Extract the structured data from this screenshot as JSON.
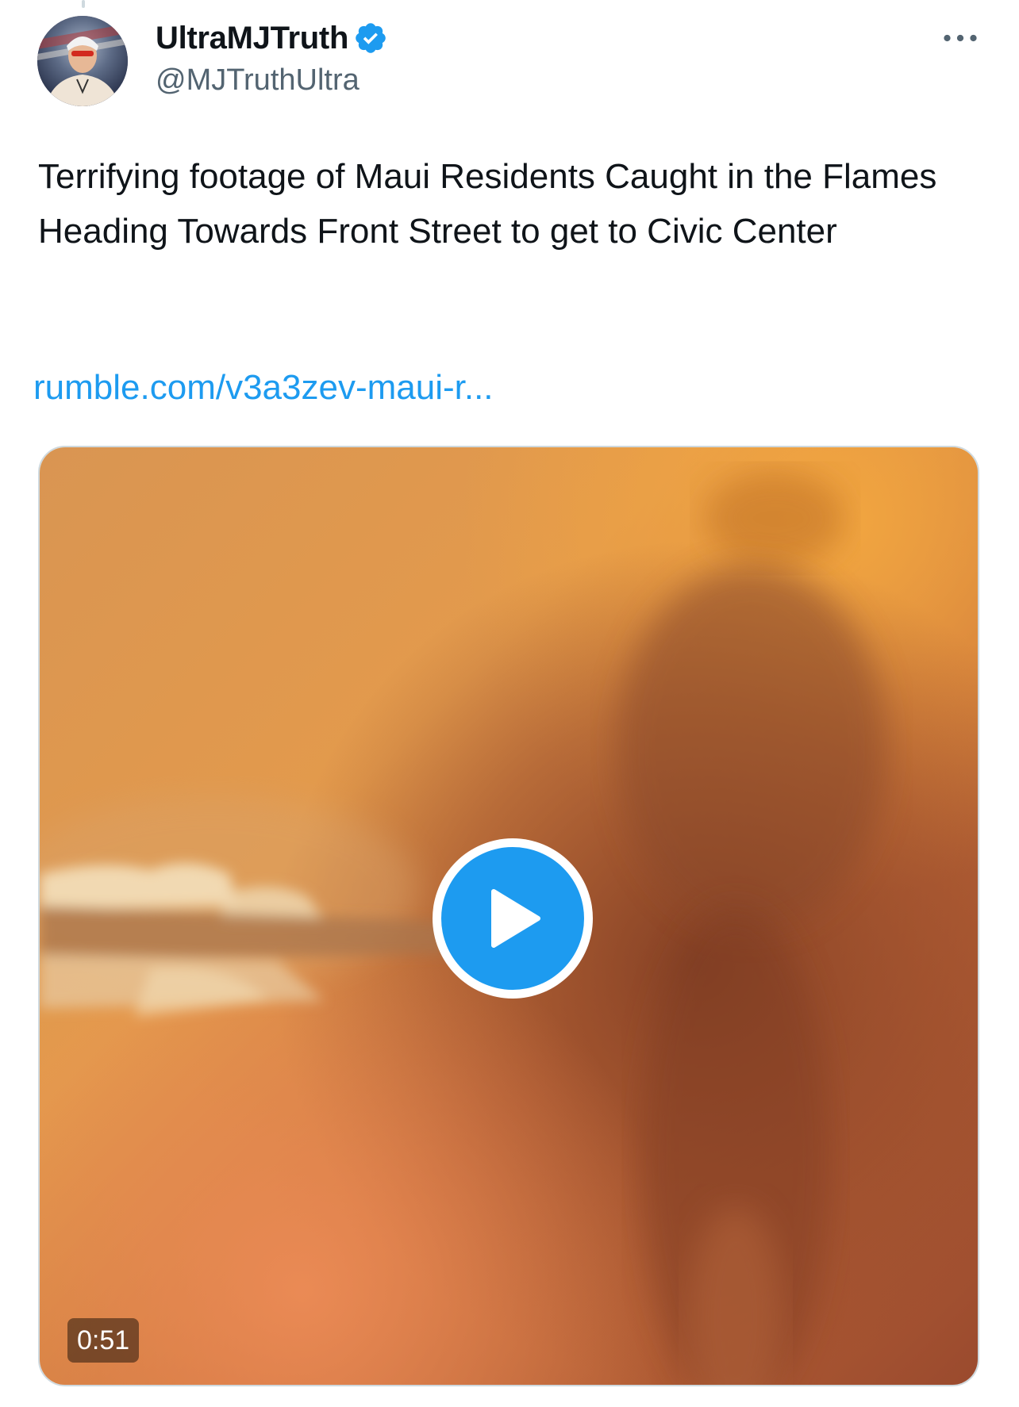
{
  "author": {
    "display_name": "UltraMJTruth",
    "handle": "@MJTruthUltra",
    "verified": true,
    "verified_color": "#1d9bf0"
  },
  "more_icon": "ellipsis-icon",
  "tweet": {
    "text": "Terrifying footage of Maui Residents Caught in the Flames Heading Towards Front Street to get to Civic Center",
    "link_text": "rumble.com/v3a3zev-maui-r..."
  },
  "media": {
    "type": "video",
    "duration": "0:51",
    "play_icon": "play-icon",
    "accent_color": "#1d9bf0"
  },
  "colors": {
    "text_primary": "#0f1419",
    "text_secondary": "#536471",
    "link": "#1d9bf0",
    "border": "#cfd9de"
  }
}
